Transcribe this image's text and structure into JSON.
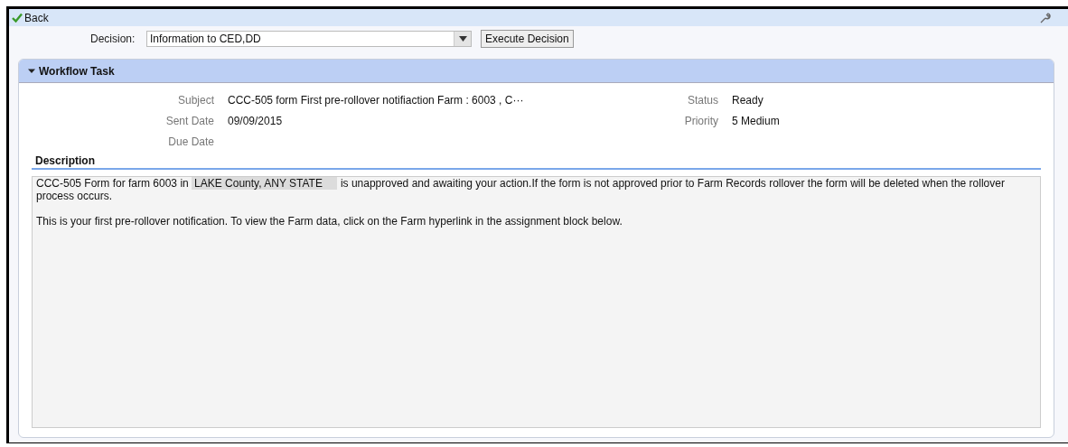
{
  "toolbar": {
    "back_label": "Back"
  },
  "decision": {
    "label": "Decision:",
    "value": "Information to CED,DD",
    "button": "Execute Decision"
  },
  "workflow_task": {
    "title": "Workflow Task",
    "expanded": true,
    "left_fields": [
      {
        "label": "Subject",
        "value": "CCC-505 form First pre-rollover notifiaction Farm : 6003 , C···"
      },
      {
        "label": "Sent Date",
        "value": "09/09/2015"
      },
      {
        "label": "Due Date"
      }
    ],
    "right_fields": [
      {
        "label": "Status",
        "value": "Ready"
      },
      {
        "label": "Priority",
        "value": "5 Medium"
      }
    ],
    "description_title": "Description",
    "description": [
      [
        {
          "text": "CCC-505 Form for farm 6003 in ",
          "highlight": false
        },
        {
          "text": "LAKE County, ANY STATE",
          "highlight": true
        },
        {
          "text": "is unapproved and awaiting your action.If the form is not approved prior to Farm Records rollover the form will be deleted when the rollover process occurs.",
          "highlight": false
        }
      ],
      [
        {
          "text": "This is your first pre-rollover notification. To view the Farm data, click on the Farm hyperlink in the assignment block below.",
          "highlight": false
        }
      ]
    ]
  }
}
